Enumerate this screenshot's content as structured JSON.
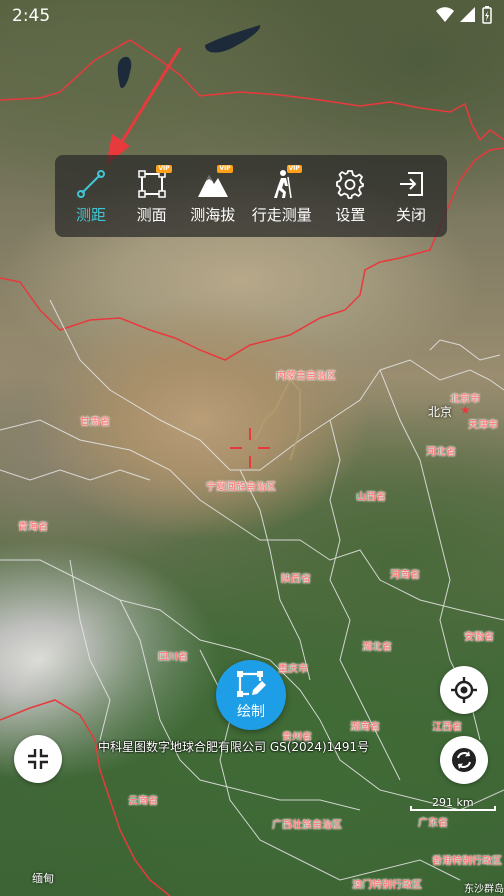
{
  "status_bar": {
    "time": "2:45"
  },
  "toolbar": {
    "items": [
      {
        "label": "测距",
        "icon": "ruler-line-icon",
        "active": true,
        "vip": false
      },
      {
        "label": "测面",
        "icon": "area-square-icon",
        "active": false,
        "vip": true
      },
      {
        "label": "测海拔",
        "icon": "mountain-icon",
        "active": false,
        "vip": true
      },
      {
        "label": "行走测量",
        "icon": "walking-person-icon",
        "active": false,
        "vip": true
      },
      {
        "label": "设置",
        "icon": "gear-icon",
        "active": false,
        "vip": false
      },
      {
        "label": "关闭",
        "icon": "exit-icon",
        "active": false,
        "vip": false
      }
    ],
    "vip_badge": "VIP"
  },
  "map": {
    "labels": {
      "inner_mongolia": "内蒙古自治区",
      "beijing_city": "北京市",
      "beijing": "北京",
      "tianjin": "天津市",
      "gansu": "甘肃省",
      "hebei": "河北省",
      "ningxia": "宁夏回族自治区",
      "shanxi": "山西省",
      "qinghai": "青海省",
      "shaanxi": "陕西省",
      "henan": "河南省",
      "sichuan": "四川省",
      "hubei": "湖北省",
      "anhui": "安徽省",
      "chongqing": "重庆市",
      "guizhou": "贵州省",
      "hunan": "湖南省",
      "jiangxi": "江西省",
      "yunnan": "云南省",
      "guangxi": "广西壮族自治区",
      "guangdong": "广东省",
      "hongkong": "香港特别行政区",
      "macau": "澳门特别行政区",
      "myanmar": "缅甸",
      "dongsha": "东沙群岛"
    },
    "copyright": "中科星图数字地球合肥有限公司  GS(2024)1491号",
    "scale": "291 km"
  },
  "draw_button": {
    "label": "绘制"
  },
  "colors": {
    "accent": "#1e9ee6",
    "active_tool": "#3fc6d4",
    "border_red": "#e8393d",
    "vip_badge": "#ff9f1a",
    "arrow_red": "#e8393d"
  }
}
